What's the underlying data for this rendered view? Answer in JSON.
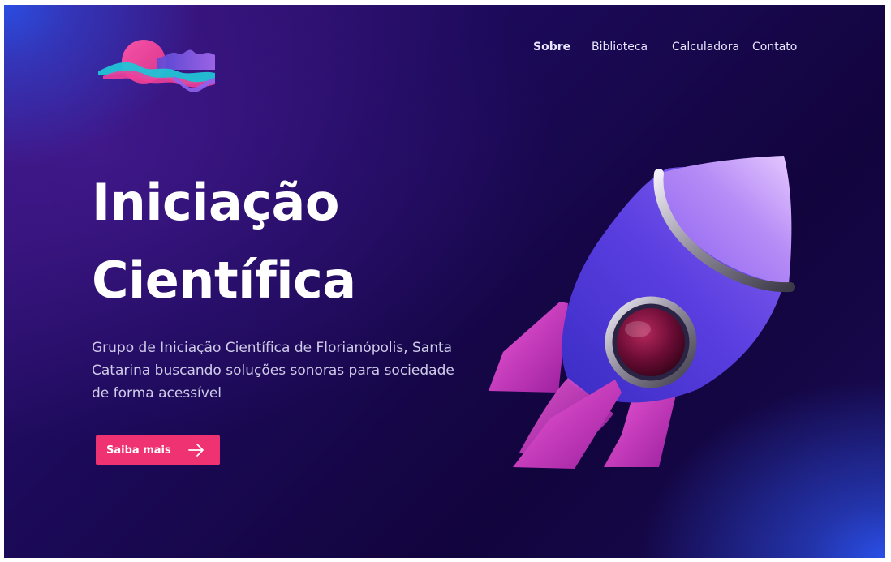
{
  "nav": {
    "items": [
      {
        "label": "Sobre",
        "active": true
      },
      {
        "label": "Biblioteca",
        "active": false
      },
      {
        "label": "Calculadora",
        "active": false
      },
      {
        "label": "Contato",
        "active": false
      }
    ]
  },
  "hero": {
    "title_line1": "Iniciação",
    "title_line2": "Científica",
    "description": "Grupo de Iniciação Científica de Florianópolis, Santa Catarina buscando soluções sonoras para sociedade de forma acessível",
    "cta_label": "Saiba mais",
    "cta_icon": "arrow-right-icon"
  },
  "logo": {
    "icon": "sound-wave-logo"
  },
  "illustration": {
    "icon": "rocket-icon"
  },
  "colors": {
    "background_dark": "#12043d",
    "background_accent": "#2b4de0",
    "cta": "#ee3272",
    "logo_pink": "#ef3f9a",
    "logo_cyan": "#22c3d6",
    "logo_violet": "#7b55e6"
  }
}
